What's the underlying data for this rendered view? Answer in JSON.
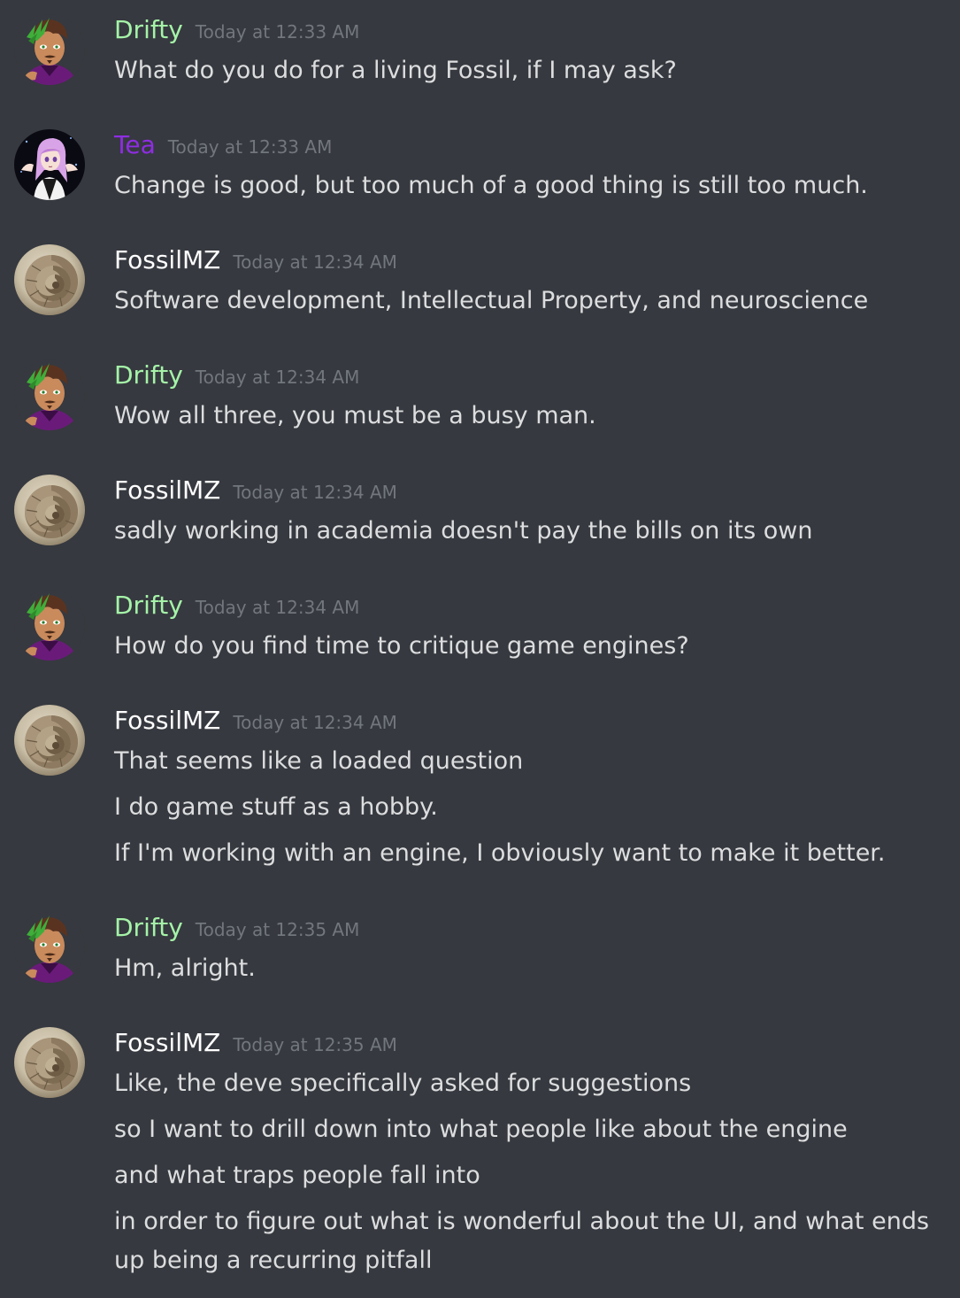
{
  "users": {
    "drifty": {
      "name": "Drifty",
      "color": "#a5f3a8",
      "avatar_icon": "drifty-avatar-icon"
    },
    "tea": {
      "name": "Tea",
      "color": "#8e2de2",
      "avatar_icon": "tea-avatar-icon"
    },
    "fossil": {
      "name": "FossilMZ",
      "color": "#ffffff",
      "avatar_icon": "ammonite-avatar-icon"
    }
  },
  "messages": [
    {
      "user": "drifty",
      "author": "Drifty",
      "timestamp": "Today at 12:33 AM",
      "lines": [
        "What do you do for a living Fossil, if I may ask?"
      ]
    },
    {
      "user": "tea",
      "author": "Tea",
      "timestamp": "Today at 12:33 AM",
      "lines": [
        "Change is good, but too much of a good thing is still too much."
      ]
    },
    {
      "user": "fossil",
      "author": "FossilMZ",
      "timestamp": "Today at 12:34 AM",
      "lines": [
        "Software development, Intellectual Property, and neuroscience"
      ]
    },
    {
      "user": "drifty",
      "author": "Drifty",
      "timestamp": "Today at 12:34 AM",
      "lines": [
        "Wow all three, you must be a busy man."
      ]
    },
    {
      "user": "fossil",
      "author": "FossilMZ",
      "timestamp": "Today at 12:34 AM",
      "lines": [
        "sadly working in academia doesn't pay the bills on its own"
      ]
    },
    {
      "user": "drifty",
      "author": "Drifty",
      "timestamp": "Today at 12:34 AM",
      "lines": [
        "How do you find time to critique game engines?"
      ]
    },
    {
      "user": "fossil",
      "author": "FossilMZ",
      "timestamp": "Today at 12:34 AM",
      "lines": [
        "That seems like a loaded question",
        "I do game stuff as a hobby.",
        "If I'm working with an engine, I obviously want to make it better."
      ]
    },
    {
      "user": "drifty",
      "author": "Drifty",
      "timestamp": "Today at 12:35 AM",
      "lines": [
        "Hm, alright."
      ]
    },
    {
      "user": "fossil",
      "author": "FossilMZ",
      "timestamp": "Today at 12:35 AM",
      "lines": [
        "Like, the deve specifically asked for suggestions",
        "so I want to drill down into what people like about the engine",
        "and what traps people fall into",
        "in order to figure out what is wonderful about the UI, and what ends up being a recurring pitfall"
      ]
    }
  ]
}
